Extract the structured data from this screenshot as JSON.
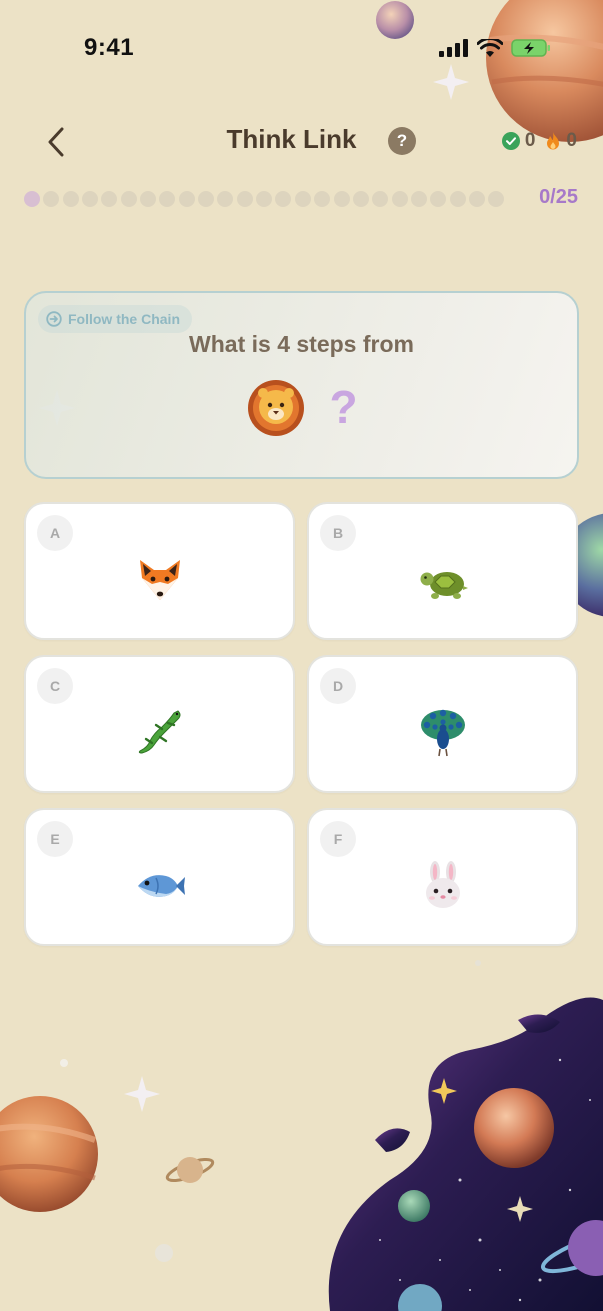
{
  "status_bar": {
    "time": "9:41"
  },
  "header": {
    "title": "Think Link",
    "help_label": "?",
    "correct_count": "0",
    "streak_count": "0"
  },
  "progress": {
    "current": 0,
    "total": 25,
    "label": "0/25"
  },
  "question": {
    "chip_label": "Follow the Chain",
    "text": "What is 4 steps from",
    "start_icon": "lion-face",
    "unknown_mark": "?"
  },
  "options": [
    {
      "letter": "A",
      "icon": "fox-face"
    },
    {
      "letter": "B",
      "icon": "turtle"
    },
    {
      "letter": "C",
      "icon": "lizard"
    },
    {
      "letter": "D",
      "icon": "peacock"
    },
    {
      "letter": "E",
      "icon": "fish"
    },
    {
      "letter": "F",
      "icon": "rabbit-face"
    }
  ],
  "colors": {
    "background": "#ece2c6",
    "accent": "#a779c9",
    "correct": "#3aa35a",
    "streak": "#f08a1c"
  }
}
